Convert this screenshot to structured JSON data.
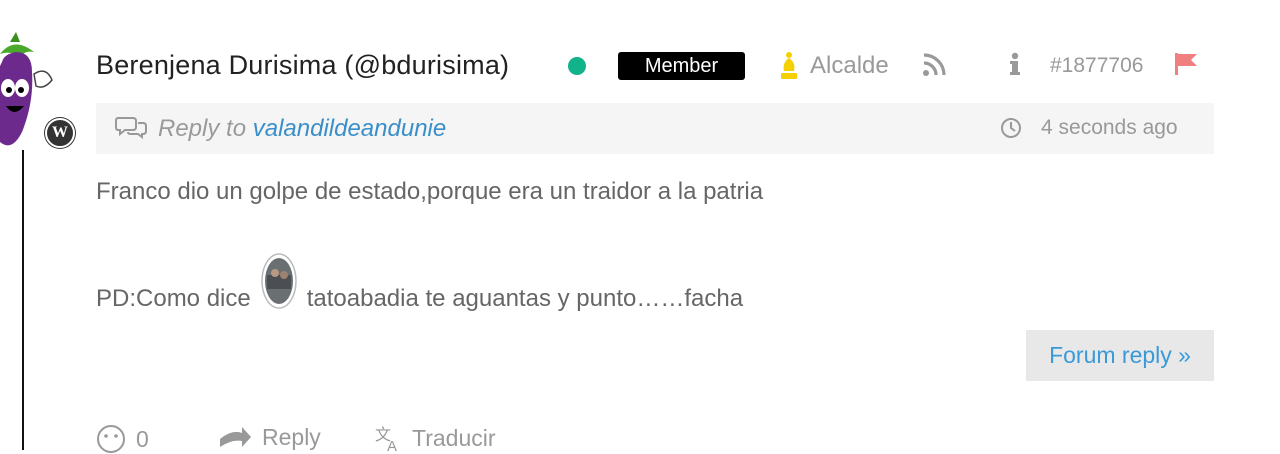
{
  "author": {
    "name": "Berenjena Durisima (@bdurisima)",
    "role_badge": "Member",
    "rank": "Alcalde",
    "post_id": "#1877706"
  },
  "reply_info": {
    "prefix": "Reply to",
    "target_user": "valandildeandunie",
    "time_ago": "4 seconds ago"
  },
  "post": {
    "line1": "Franco dio un golpe de estado,porque era un traidor a la patria",
    "line2_before": "PD:Como dice",
    "line2_after": "tatoabadia te aguantas y punto……facha"
  },
  "actions": {
    "forum_reply": "Forum reply »",
    "reactions_count": "0",
    "reply": "Reply",
    "translate": "Traducir"
  },
  "colors": {
    "online": "#10b38a",
    "link": "#3a8fc9",
    "rank_icon": "#f5d000",
    "flag": "#f08080"
  },
  "icons": [
    "eggplant-avatar",
    "wordpress-icon",
    "online-status-dot",
    "bishop-rank-icon",
    "rss-icon",
    "info-icon",
    "flag-icon",
    "reply-bubbles-icon",
    "clock-icon",
    "smiley-icon",
    "reply-arrow-icon",
    "translate-icon"
  ]
}
